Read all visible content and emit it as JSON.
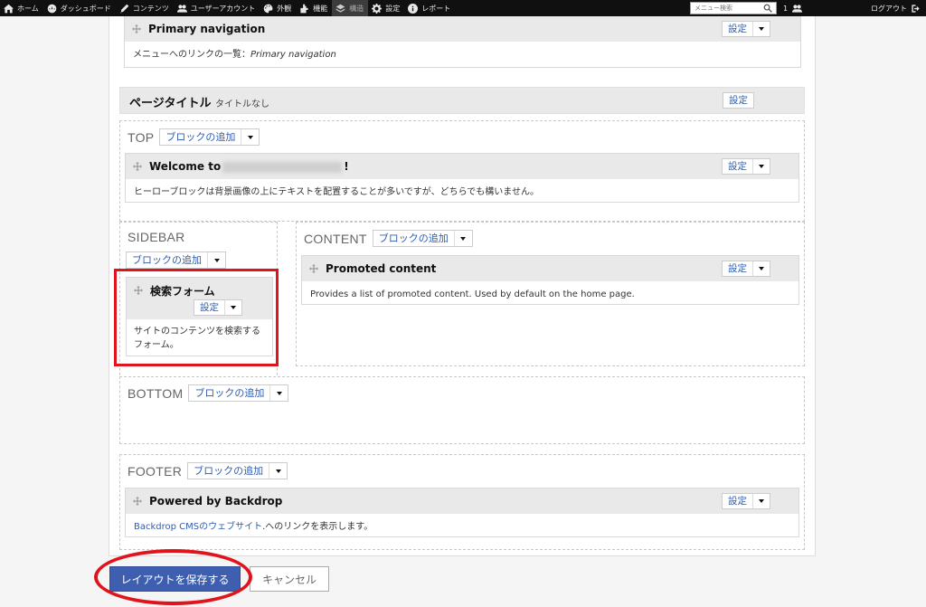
{
  "adminbar": {
    "items": [
      {
        "label": "ホーム",
        "icon": "home-icon"
      },
      {
        "label": "ダッシュボード",
        "icon": "dashboard-icon"
      },
      {
        "label": "コンテンツ",
        "icon": "pencil-icon"
      },
      {
        "label": "ユーザーアカウント",
        "icon": "users-icon"
      },
      {
        "label": "外観",
        "icon": "palette-icon"
      },
      {
        "label": "機能",
        "icon": "puzzle-icon"
      },
      {
        "label": "構造",
        "icon": "layers-icon"
      },
      {
        "label": "設定",
        "icon": "gear-icon"
      },
      {
        "label": "レポート",
        "icon": "info-icon"
      }
    ],
    "search_placeholder": "メニュー検索",
    "user_count": "1",
    "logout_label": "ログアウト"
  },
  "layout": {
    "primary_nav": {
      "title": "Primary navigation",
      "desc_prefix": "メニューへのリンクの一覧：",
      "desc_em": "Primary navigation",
      "config_label": "設定"
    },
    "page_title": {
      "title": "ページタイトル",
      "subtitle": "タイトルなし",
      "config_label": "設定"
    },
    "top": {
      "title": "TOP",
      "add_label": "ブロックの追加",
      "block_title_prefix": "Welcome to",
      "block_title_suffix": "!",
      "block_desc": "ヒーローブロックは背景画像の上にテキストを配置することが多いですが、どちらでも構いません。",
      "config_label": "設定"
    },
    "sidebar": {
      "title": "SIDEBAR",
      "add_label": "ブロックの追加",
      "block_title": "検索フォーム",
      "block_desc": "サイトのコンテンツを検索するフォーム。",
      "config_label": "設定"
    },
    "content": {
      "title": "CONTENT",
      "add_label": "ブロックの追加",
      "block_title": "Promoted content",
      "block_desc": "Provides a list of promoted content. Used by default on the home page.",
      "config_label": "設定"
    },
    "bottom": {
      "title": "BOTTOM",
      "add_label": "ブロックの追加"
    },
    "footer": {
      "title": "FOOTER",
      "add_label": "ブロックの追加",
      "block_title": "Powered by Backdrop",
      "block_desc_link": "Backdrop CMSのウェブサイト",
      "block_desc_rest": ".へのリンクを表示します。",
      "config_label": "設定"
    }
  },
  "actions": {
    "save_label": "レイアウトを保存する",
    "cancel_label": "キャンセル"
  },
  "colors": {
    "accent": "#3e5fb0",
    "link": "#2f5cb0",
    "highlight": "#e0141c",
    "adminbar_bg": "#101010"
  }
}
